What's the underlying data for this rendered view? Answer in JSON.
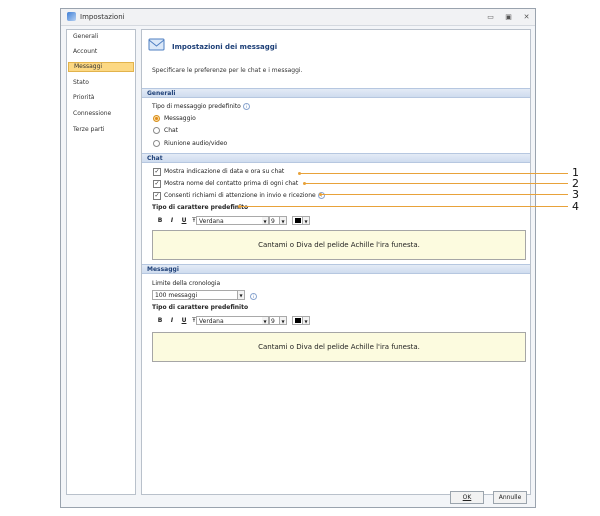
{
  "window": {
    "title": "Impostazioni"
  },
  "window_buttons": {
    "minimize": "▭",
    "restore": "▣",
    "close": "✕"
  },
  "sidebar": {
    "items": [
      {
        "label": "Generali"
      },
      {
        "label": "Account"
      },
      {
        "label": "Messaggi",
        "selected": true
      },
      {
        "label": "Stato"
      },
      {
        "label": "Priorità"
      },
      {
        "label": "Connessione"
      },
      {
        "label": "Terze parti"
      }
    ]
  },
  "header": {
    "icon": "envelope-icon",
    "title": "Impostazioni dei messaggi",
    "description": "Specificare le preferenze per le chat e i messaggi."
  },
  "general": {
    "section_title": "Generali",
    "type_label": "Tipo di messaggio predefinito",
    "options": [
      {
        "label": "Messaggio",
        "selected": true
      },
      {
        "label": "Chat",
        "selected": false
      },
      {
        "label": "Riunione audio/video",
        "selected": false
      }
    ]
  },
  "chat": {
    "section_title": "Chat",
    "checkboxes": [
      {
        "label": "Mostra indicazione di data e ora su chat",
        "checked": true
      },
      {
        "label": "Mostra nome del contatto prima di ogni chat",
        "checked": true
      },
      {
        "label": "Consenti richiami di attenzione in invio e ricezione",
        "checked": true
      }
    ],
    "font_label": "Tipo di carattere predefinito",
    "toolbar": {
      "bold": "B",
      "italic": "I",
      "underline": "U",
      "font": "Verdana",
      "size": "9",
      "color": "#000000"
    },
    "preview_text": "Cantami o Diva del pelide Achille l'ira funesta."
  },
  "messages": {
    "section_title": "Messaggi",
    "history_label": "Limite della cronologia",
    "history_value": "100 messaggi",
    "font_label": "Tipo di carattere predefinito",
    "toolbar": {
      "bold": "B",
      "italic": "I",
      "underline": "U",
      "font": "Verdana",
      "size": "9",
      "color": "#000000"
    },
    "preview_text": "Cantami o Diva del pelide Achille l'ira funesta."
  },
  "footer": {
    "ok": "OK",
    "cancel": "Annulle"
  },
  "callouts": [
    "1",
    "2",
    "3",
    "4"
  ],
  "colors": {
    "accent": "#e8a23a",
    "selected_nav": "#fcd883",
    "section_band": "#dce6f4",
    "preview_bg": "#fcfbdf"
  }
}
